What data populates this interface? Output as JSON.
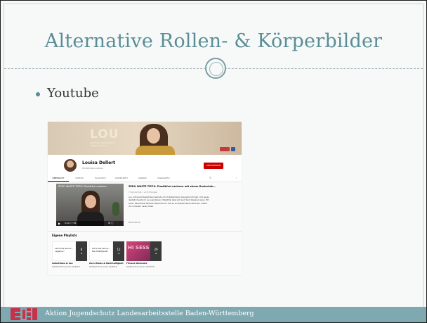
{
  "slide": {
    "title": "Alternative Rollen- & Körperbilder",
    "bullet": "Youtube",
    "footer": "Aktion Jugendschutz Landesarbeitsstelle Baden-Württemberg"
  },
  "youtube": {
    "banner": {
      "logo": "LOU",
      "subtitle": "POLITISCH NACHHALTIG MINIMALISTISCH"
    },
    "channel": {
      "name": "Louisa Dellert",
      "subscribers": "95.000 Abonnenten",
      "subscribe_label": "ABONNIEREN"
    },
    "tabs": [
      "ÜBERSICHT",
      "VIDEOS",
      "PLAYLISTS",
      "COMMUNITY",
      "KANÄLE",
      "KANALINFO"
    ],
    "video": {
      "overlay_title": "ZERO WASTE TIPPS: Plastikfrei rasieren",
      "time": "0:00 / 7:38",
      "title": "ZERO WASTE TIPPS: Plastikfrei rasieren mit einem Rasierhob...",
      "meta": "7.220 Aufrufe • vor 4 Monaten",
      "description": "Lou, mit einem Rasierhobel verbinde ich im Badezimmer. Das geht nicht gut. Und genau deshalb musste ich es ausprobieren. Plastikfrei lässt sich auch beim Rasieren leben. Mit einem Rasierhobel fällt kein Rasiermüll an. Wie es ein Rasierhobel funktioniert, erfahrt ihr in meinem neuen Video.",
      "more": "MEHR INFOS"
    },
    "playlists_heading": "Eigene Playlists",
    "playlists": [
      {
        "thumb_text": "Let's talk about... veganer!",
        "count": "8",
        "label": "Selbstliebe & Sex",
        "link": "KOMPLETTE PLAYLIST ANSEHEN"
      },
      {
        "thumb_text": "Let's talk about... Nachhaltigkeit!",
        "count": "12",
        "label": "Zero Waste & Nachhaltigkeit",
        "link": "KOMPLETTE PLAYLIST ANSEHEN"
      },
      {
        "thumb_text": "HI SESS",
        "count": "29",
        "label": "Fitness Workouts",
        "link": "KOMPLETTE PLAYLIST ANSEHEN"
      }
    ]
  }
}
